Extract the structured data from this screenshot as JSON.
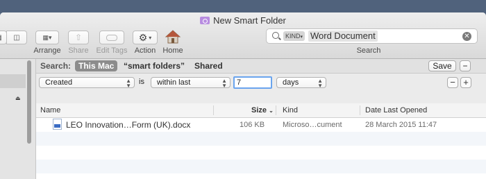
{
  "window": {
    "title": "New Smart Folder"
  },
  "toolbar": {
    "arrange_label": "Arrange",
    "share_label": "Share",
    "edit_tags_label": "Edit Tags",
    "action_label": "Action",
    "home_label": "Home",
    "search_label": "Search"
  },
  "search": {
    "token_kind": "KIND",
    "token_value": "Word Document"
  },
  "scope": {
    "label": "Search:",
    "this_mac": "This Mac",
    "smart_folders": "“smart folders”",
    "shared": "Shared",
    "save_label": "Save",
    "minus": "−"
  },
  "criteria": {
    "attribute": "Created",
    "is_label": "is",
    "operator": "within last",
    "amount": "7",
    "unit": "days",
    "remove": "−",
    "add": "+"
  },
  "columns": {
    "name": "Name",
    "size": "Size",
    "kind": "Kind",
    "date": "Date Last Opened"
  },
  "files": [
    {
      "name": "LEO Innovation…Form (UK).docx",
      "size": "106 KB",
      "kind": "Microso…cument",
      "date": "28 March 2015 11:47"
    }
  ],
  "colors": {
    "accent": "#6aa4ee",
    "scope_selected": "#8c8c8c",
    "folder_purple": "#b88de0"
  }
}
